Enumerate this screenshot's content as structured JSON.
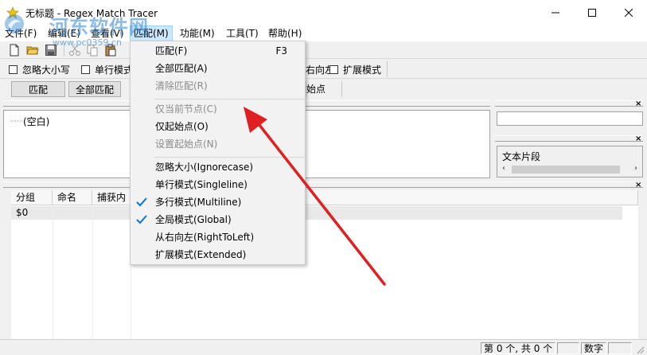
{
  "window": {
    "title": "无标题 - Regex Match Tracer"
  },
  "watermark": {
    "site_name": "河东软件网",
    "url": "www.pc0359.cn"
  },
  "menubar": {
    "items": [
      "文件(F)",
      "编辑(E)",
      "查看(V)",
      "匹配(M)",
      "功能(M)",
      "工具(T)",
      "帮助(H)"
    ]
  },
  "options": {
    "ignorecase": "忽略大小写",
    "singleline": "单行模式",
    "righttoleft_partial": "右向左",
    "extended": "扩展模式"
  },
  "actions": {
    "match": "匹配",
    "match_all": "全部匹配",
    "start_point_partial": "始点"
  },
  "tree": {
    "root": "(空白)"
  },
  "right_panel": {
    "fragment_label": "文本片段"
  },
  "results": {
    "columns": [
      "分组",
      "命名",
      "捕获内"
    ],
    "rows": [
      [
        "$0",
        "",
        ""
      ]
    ]
  },
  "status": {
    "count": "第 0 个, 共 0 个",
    "numlock": "数字"
  },
  "dropdown": {
    "items": [
      {
        "label": "匹配(F)",
        "shortcut": "F3",
        "enabled": true,
        "checked": false
      },
      {
        "label": "全部匹配(A)",
        "shortcut": "",
        "enabled": true,
        "checked": false
      },
      {
        "label": "清除匹配(R)",
        "shortcut": "",
        "enabled": false,
        "checked": false
      },
      {
        "label": "仅当前节点(C)",
        "shortcut": "",
        "enabled": false,
        "checked": false
      },
      {
        "label": "仅起始点(O)",
        "shortcut": "",
        "enabled": true,
        "checked": false
      },
      {
        "label": "设置起始点(N)",
        "shortcut": "",
        "enabled": false,
        "checked": false
      },
      {
        "label": "忽略大小(Ignorecase)",
        "shortcut": "",
        "enabled": true,
        "checked": false
      },
      {
        "label": "单行模式(Singleline)",
        "shortcut": "",
        "enabled": true,
        "checked": false
      },
      {
        "label": "多行模式(Multiline)",
        "shortcut": "",
        "enabled": true,
        "checked": true
      },
      {
        "label": "全局模式(Global)",
        "shortcut": "",
        "enabled": true,
        "checked": true
      },
      {
        "label": "从右向左(RightToLeft)",
        "shortcut": "",
        "enabled": true,
        "checked": false
      },
      {
        "label": "扩展模式(Extended)",
        "shortcut": "",
        "enabled": true,
        "checked": false
      }
    ]
  },
  "colors": {
    "accent": "#0078d7",
    "menu_highlight": "#cce8ff",
    "annotation_arrow": "#e02020"
  }
}
